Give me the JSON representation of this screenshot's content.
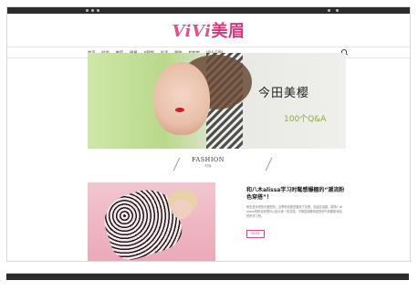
{
  "topbar": {
    "left_items": [
      "",
      "",
      ""
    ],
    "right_items": [
      "",
      ""
    ]
  },
  "logo": {
    "vivi": "ViVi",
    "cn": "美眉"
  },
  "nav": {
    "items": [
      "首页",
      "时尚",
      "美容",
      "明星",
      "V视频",
      "生活",
      "图鉴",
      "哔哔哔",
      "ViVi GIRL"
    ]
  },
  "hero": {
    "name": "今田美樱",
    "subtitle": "100个Q&A"
  },
  "section": {
    "title": "FASHION",
    "subtitle": "时尚"
  },
  "article": {
    "title": "和八木alissa学习时髦感爆棚的“潮流粉色穿搭”！",
    "body": "粉色是永恒的可爱配色，这季粉色更是潮流了百搭。说起这话题，模特八木alissa的粉色穿搭可以给大家一些灵感，不管是甜美风还是帅气风都能驾驭，快来学习吧。",
    "read_more": "MORE"
  }
}
